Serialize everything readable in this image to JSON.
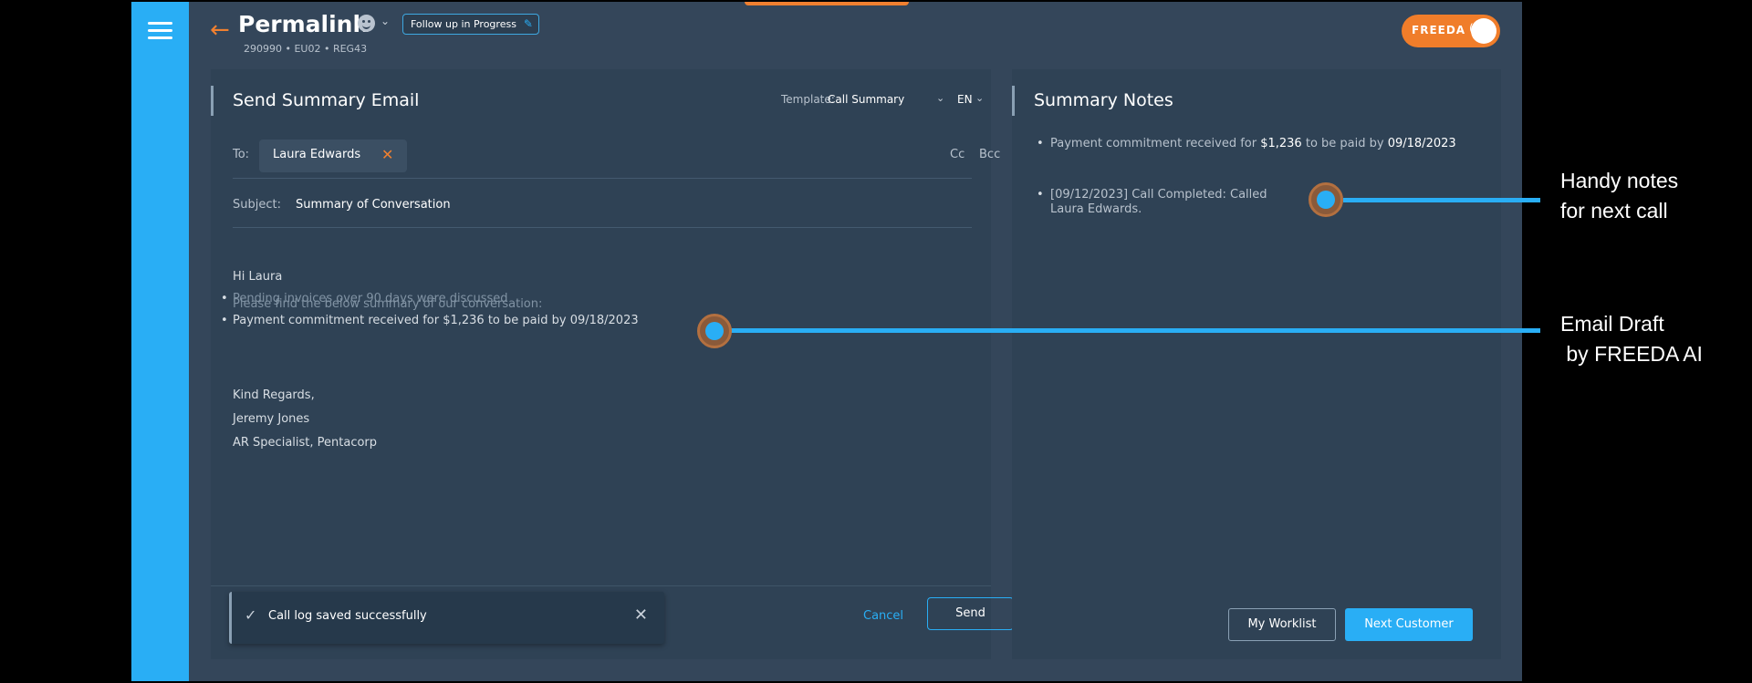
{
  "app": {
    "title": "Permalink",
    "status_chip": "Follow up in Progress",
    "subline": "290990 • EU02 • REG43",
    "assistant_label": "FREEDA",
    "accent_color": "#29aef5",
    "brand_color": "#f08030"
  },
  "email": {
    "heading": "Send Summary Email",
    "template_label": "Template:",
    "template_value": "Call Summary",
    "language": "EN",
    "to_label": "To:",
    "recipient": "Laura Edwards",
    "cc_label": "Cc",
    "bcc_label": "Bcc",
    "subject_label": "Subject:",
    "subject_value": "Summary of Conversation",
    "greeting": "Hi Laura",
    "faded_bullet": "Pending invoices over 90 days were discussed",
    "intro": "Please find the below summary of our conversation:",
    "bullet": "Payment commitment received for $1,236 to be paid by 09/18/2023",
    "signoff": "Kind Regards,",
    "sender_name": "Jeremy Jones",
    "sender_title": "AR Specialist, Pentacorp",
    "toast_message": "Call log saved successfully",
    "cancel_label": "Cancel",
    "send_label": "Send"
  },
  "notes": {
    "heading": "Summary Notes",
    "note1": {
      "prefix": "Payment commitment received for ",
      "amount": "$1,236",
      "middle": " to be paid by ",
      "date": "09/18/2023"
    },
    "note2_line1": "[09/12/2023] Call Completed: Called",
    "note2_line2": "Laura Edwards.",
    "worklist_label": "My Worklist",
    "next_label": "Next Customer"
  },
  "annotations": {
    "notes_line1": "Handy notes",
    "notes_line2": "for next call",
    "email_line1": "Email Draft",
    "email_line2": " by FREEDA AI"
  }
}
